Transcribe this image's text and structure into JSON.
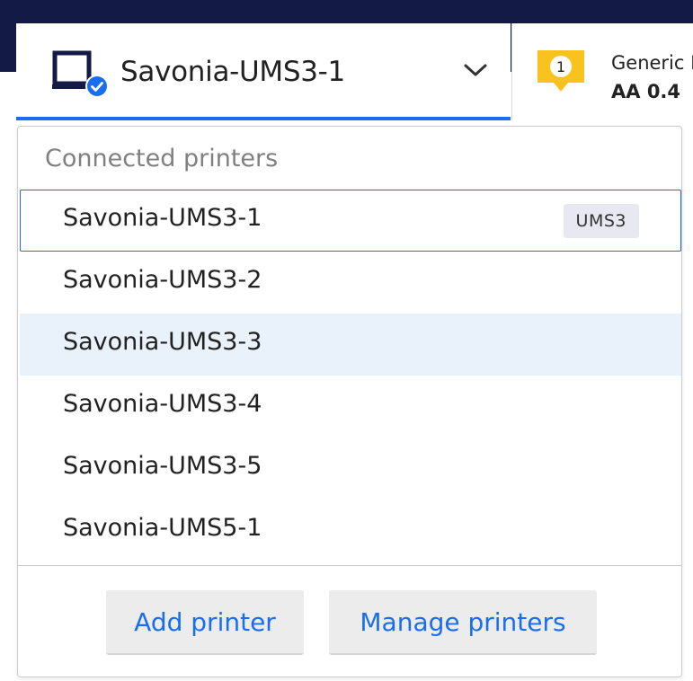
{
  "selector": {
    "active_printer": "Savonia-UMS3-1",
    "status": "connected"
  },
  "material": {
    "extruder_number": "1",
    "name": "Generic P",
    "nozzle": "AA 0.4"
  },
  "dropdown": {
    "section_title": "Connected printers",
    "printers": [
      {
        "label": "Savonia-UMS3-1",
        "type": "UMS3",
        "state": "selected"
      },
      {
        "label": "Savonia-UMS3-2",
        "type": "",
        "state": ""
      },
      {
        "label": "Savonia-UMS3-3",
        "type": "",
        "state": "hover"
      },
      {
        "label": "Savonia-UMS3-4",
        "type": "",
        "state": ""
      },
      {
        "label": "Savonia-UMS3-5",
        "type": "",
        "state": ""
      },
      {
        "label": "Savonia-UMS5-1",
        "type": "",
        "state": ""
      }
    ],
    "add_printer": "Add printer",
    "manage_printers": "Manage printers"
  },
  "colors": {
    "header_bg": "#141a46",
    "accent": "#196ef0",
    "badge_yellow": "#f9c21f",
    "hover_bg": "#e9f1fb"
  }
}
